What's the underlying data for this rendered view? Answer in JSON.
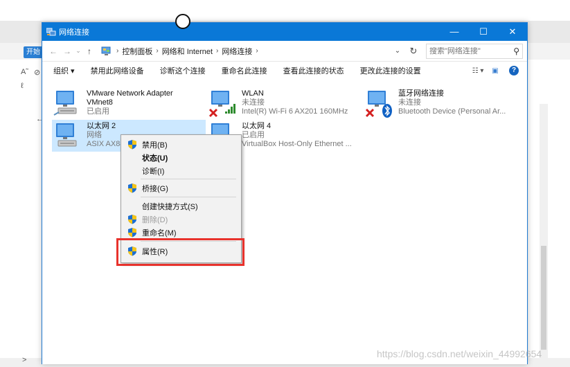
{
  "window": {
    "title": "网络连接",
    "controls": [
      "—",
      "☐",
      "✕"
    ]
  },
  "background": {
    "start_button": "开始",
    "glyphs": [
      "A˜",
      "⊘",
      "ℓ",
      "↶",
      "←",
      ">"
    ]
  },
  "address": {
    "back": "←",
    "forward": "→",
    "dropdown_small": "⌄",
    "up": "↑",
    "breadcrumbs": [
      "控制面板",
      "网络和 Internet",
      "网络连接"
    ],
    "separator": "›",
    "dropdown": "⌄",
    "refresh": "↻",
    "search_placeholder": "搜索\"网络连接\"",
    "search_icon": "⚲"
  },
  "commands": [
    "组织 ▾",
    "禁用此网络设备",
    "诊断这个连接",
    "重命名此连接",
    "查看此连接的状态",
    "更改此连接的设置"
  ],
  "command_right": {
    "view": "☷ ▾",
    "pane": "▣",
    "help": "?"
  },
  "connections": [
    {
      "name": "VMware Network Adapter VMnet8",
      "name_line1": "VMware Network Adapter",
      "name_line2": "VMnet8",
      "status": "已启用",
      "device": "",
      "icon": "network-adapter-icon",
      "badge": ""
    },
    {
      "name": "WLAN",
      "status": "未连接",
      "device": "Intel(R) Wi-Fi 6 AX201 160MHz",
      "icon": "wifi-adapter-icon",
      "badge": "disconnected-x-icon"
    },
    {
      "name": "蓝牙网络连接",
      "status": "未连接",
      "device": "Bluetooth Device (Personal Ar...",
      "icon": "bluetooth-adapter-icon",
      "badge": "disconnected-x-icon"
    },
    {
      "name": "以太网 2",
      "status": "网络",
      "device": "ASIX AX88",
      "icon": "network-adapter-icon",
      "badge": "",
      "selected": true
    },
    {
      "name": "以太网 4",
      "status": "已启用",
      "device": "VirtualBox Host-Only Ethernet ...",
      "icon": "network-adapter-icon",
      "badge": ""
    }
  ],
  "context_menu": {
    "items": [
      {
        "label": "禁用(B)",
        "shield": true,
        "bold": false,
        "disabled": false
      },
      {
        "label": "状态(U)",
        "shield": false,
        "bold": true,
        "disabled": false
      },
      {
        "label": "诊断(I)",
        "shield": false,
        "bold": false,
        "disabled": false
      },
      {
        "label": "桥接(G)",
        "shield": true,
        "bold": false,
        "disabled": false
      },
      {
        "label": "创建快捷方式(S)",
        "shield": false,
        "bold": false,
        "disabled": false
      },
      {
        "label": "删除(D)",
        "shield": true,
        "bold": false,
        "disabled": true
      },
      {
        "label": "重命名(M)",
        "shield": true,
        "bold": false,
        "disabled": false
      },
      {
        "label": "属性(R)",
        "shield": true,
        "bold": false,
        "disabled": false
      }
    ]
  },
  "watermark": "https://blog.csdn.net/weixin_44992654",
  "colors": {
    "titlebar": "#0a78d7",
    "selection": "#cce8ff",
    "highlight_box": "#e8322c",
    "shield_blue": "#1c6fd1",
    "shield_yellow": "#f5c518"
  }
}
